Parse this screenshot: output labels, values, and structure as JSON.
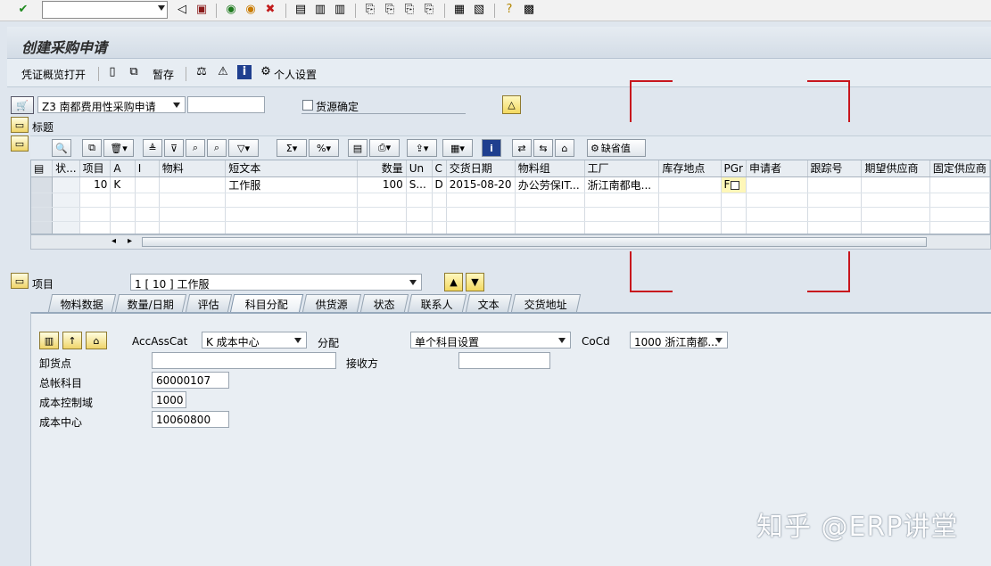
{
  "window": {
    "title": "创建采购申请"
  },
  "app_toolbar": {
    "items": [
      "凭证概览打开",
      "暂存",
      "个人设置"
    ]
  },
  "header": {
    "doc_type": "Z3 南都费用性采购申请",
    "doc_number": "",
    "source_determination_label": "货源确定",
    "source_determination_checked": false,
    "title_label": "标题"
  },
  "grid_toolbar": {
    "default_values_label": "缺省值"
  },
  "grid": {
    "columns": [
      "状...",
      "项目",
      "A",
      "I",
      "物料",
      "短文本",
      "数量",
      "Un",
      "C",
      "交货日期",
      "物料组",
      "工厂",
      "库存地点",
      "PGr",
      "申请者",
      "跟踪号",
      "期望供应商",
      "固定供应商"
    ],
    "rows": [
      [
        "",
        "10",
        "K",
        "",
        "",
        "工作服",
        "100",
        "S...",
        "D",
        "2015-08-20",
        "办公劳保IT...",
        "浙江南都电...",
        "",
        "F",
        "",
        "",
        "",
        ""
      ]
    ]
  },
  "item": {
    "label": "项目",
    "selected": "1 [ 10 ] 工作服"
  },
  "tabs": [
    "物料数据",
    "数量/日期",
    "评估",
    "科目分配",
    "供货源",
    "状态",
    "联系人",
    "文本",
    "交货地址"
  ],
  "active_tab": "科目分配",
  "account_assignment": {
    "acc_ass_cat_label": "AccAssCat",
    "acc_ass_cat_value": "K 成本中心",
    "distribution_label": "分配",
    "distribution_value": "单个科目设置",
    "cocd_label": "CoCd",
    "cocd_value": "1000 浙江南都...",
    "unloading_point_label": "卸货点",
    "unloading_point_value": "",
    "recipient_label": "接收方",
    "recipient_value": "",
    "gl_account_label": "总帐科目",
    "gl_account_value": "60000107",
    "co_area_label": "成本控制域",
    "co_area_value": "1000",
    "cost_center_label": "成本中心",
    "cost_center_value": "10060800"
  },
  "watermark": "知乎 @ERP讲堂"
}
